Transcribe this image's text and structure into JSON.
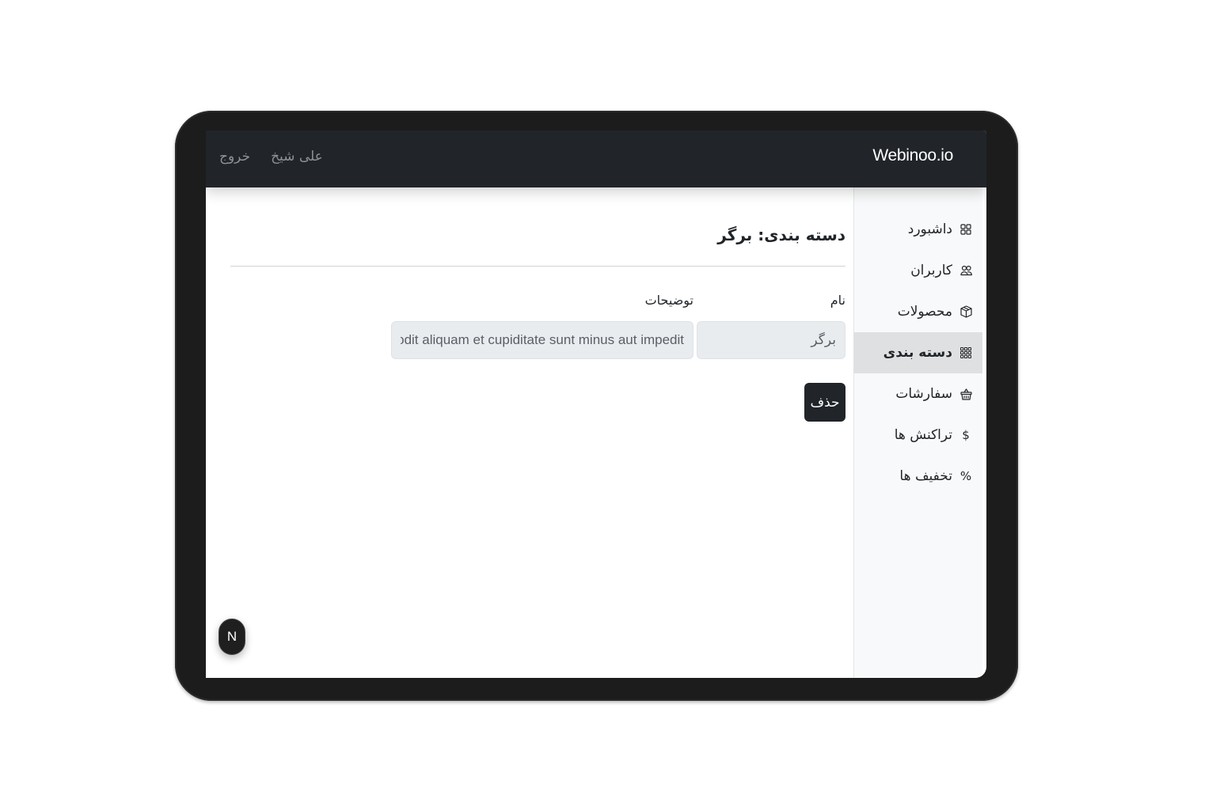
{
  "navbar": {
    "brand": "Webinoo.io",
    "user_name": "علی شیخ",
    "logout_label": "خروج"
  },
  "sidebar": {
    "items": [
      {
        "label": "داشبورد",
        "icon": "grid-icon",
        "active": false
      },
      {
        "label": "کاربران",
        "icon": "users-icon",
        "active": false
      },
      {
        "label": "محصولات",
        "icon": "box-icon",
        "active": false
      },
      {
        "label": "دسته بندی",
        "icon": "grid-3x3-icon",
        "active": true
      },
      {
        "label": "سفارشات",
        "icon": "basket-icon",
        "active": false
      },
      {
        "label": "تراکنش ها",
        "icon": "dollar-icon",
        "active": false
      },
      {
        "label": "تخفیف ها",
        "icon": "percent-icon",
        "active": false
      }
    ]
  },
  "page": {
    "title": "دسته بندی: برگر"
  },
  "form": {
    "name_label": "نام",
    "name_value": "برگر",
    "description_label": "توضیحات",
    "description_value": "Dignissimos vel odit aliquam et cupiditate sunt minus aut impedit",
    "delete_label": "حذف"
  },
  "fab": {
    "label": "N"
  }
}
